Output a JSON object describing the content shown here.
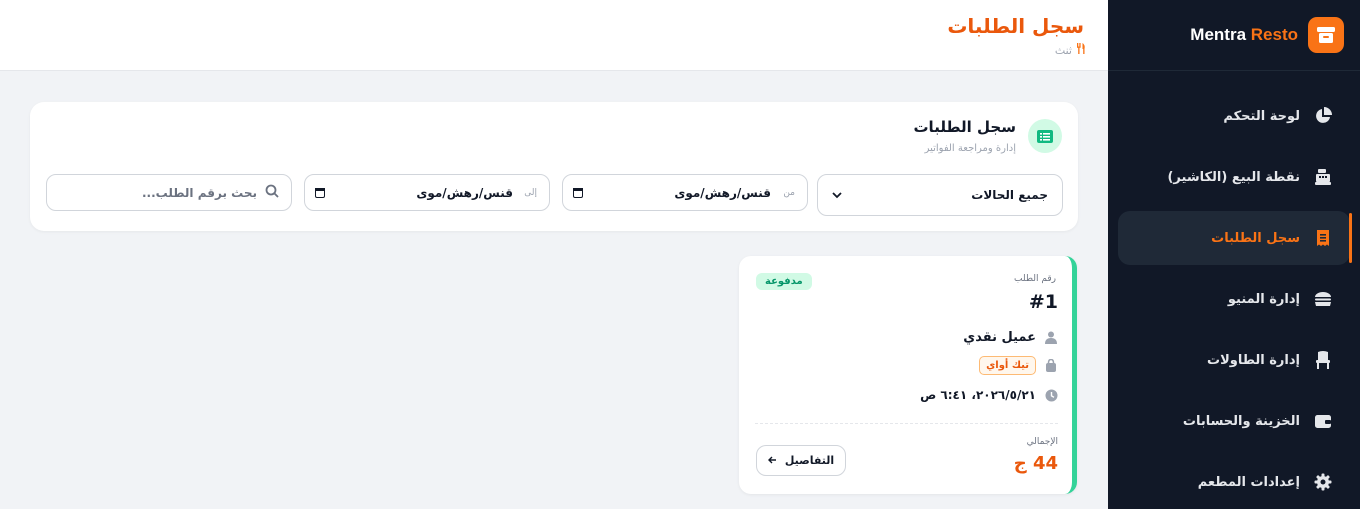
{
  "brand": {
    "name_part1": "Mentra",
    "name_part2": "Resto"
  },
  "sidebar": {
    "items": [
      {
        "label": "لوحة التحكم",
        "icon": "pie-chart-icon"
      },
      {
        "label": "نقطة البيع (الكاشير)",
        "icon": "cash-register-icon"
      },
      {
        "label": "سجل الطلبات",
        "icon": "receipt-icon",
        "active": true
      },
      {
        "label": "إدارة المنيو",
        "icon": "burger-icon"
      },
      {
        "label": "إدارة الطاولات",
        "icon": "chair-icon"
      },
      {
        "label": "الخزينة والحسابات",
        "icon": "wallet-icon"
      },
      {
        "label": "إعدادات المطعم",
        "icon": "gear-icon"
      }
    ]
  },
  "header": {
    "title": "سجل الطلبات",
    "breadcrumb": "ثنث"
  },
  "filters": {
    "title": "سجل الطلبات",
    "subtitle": "إدارة ومراجعة الفواتير",
    "status_value": "جميع الحالات",
    "from_prefix": "من",
    "from_value": "قنس/رهش/موى",
    "to_prefix": "إلى",
    "to_value": "قنس/رهش/موى",
    "search_placeholder": "بحث برقم الطلب..."
  },
  "order": {
    "number_label": "رقم الطلب",
    "number": "#1",
    "status": "مدفوعة",
    "customer": "عميل نقدي",
    "type": "تيك أواي",
    "datetime": "٢٠٢٦/٥/٢١، ٦:٤١ ص",
    "total_label": "الإجمالي",
    "total": "44 ج",
    "details_label": "التفاصيل"
  },
  "colors": {
    "accent": "#f97316",
    "sidebar_bg": "#111827",
    "paid_badge_bg": "#d1fae5",
    "paid_badge_text": "#059669",
    "card_border": "#34d399"
  }
}
